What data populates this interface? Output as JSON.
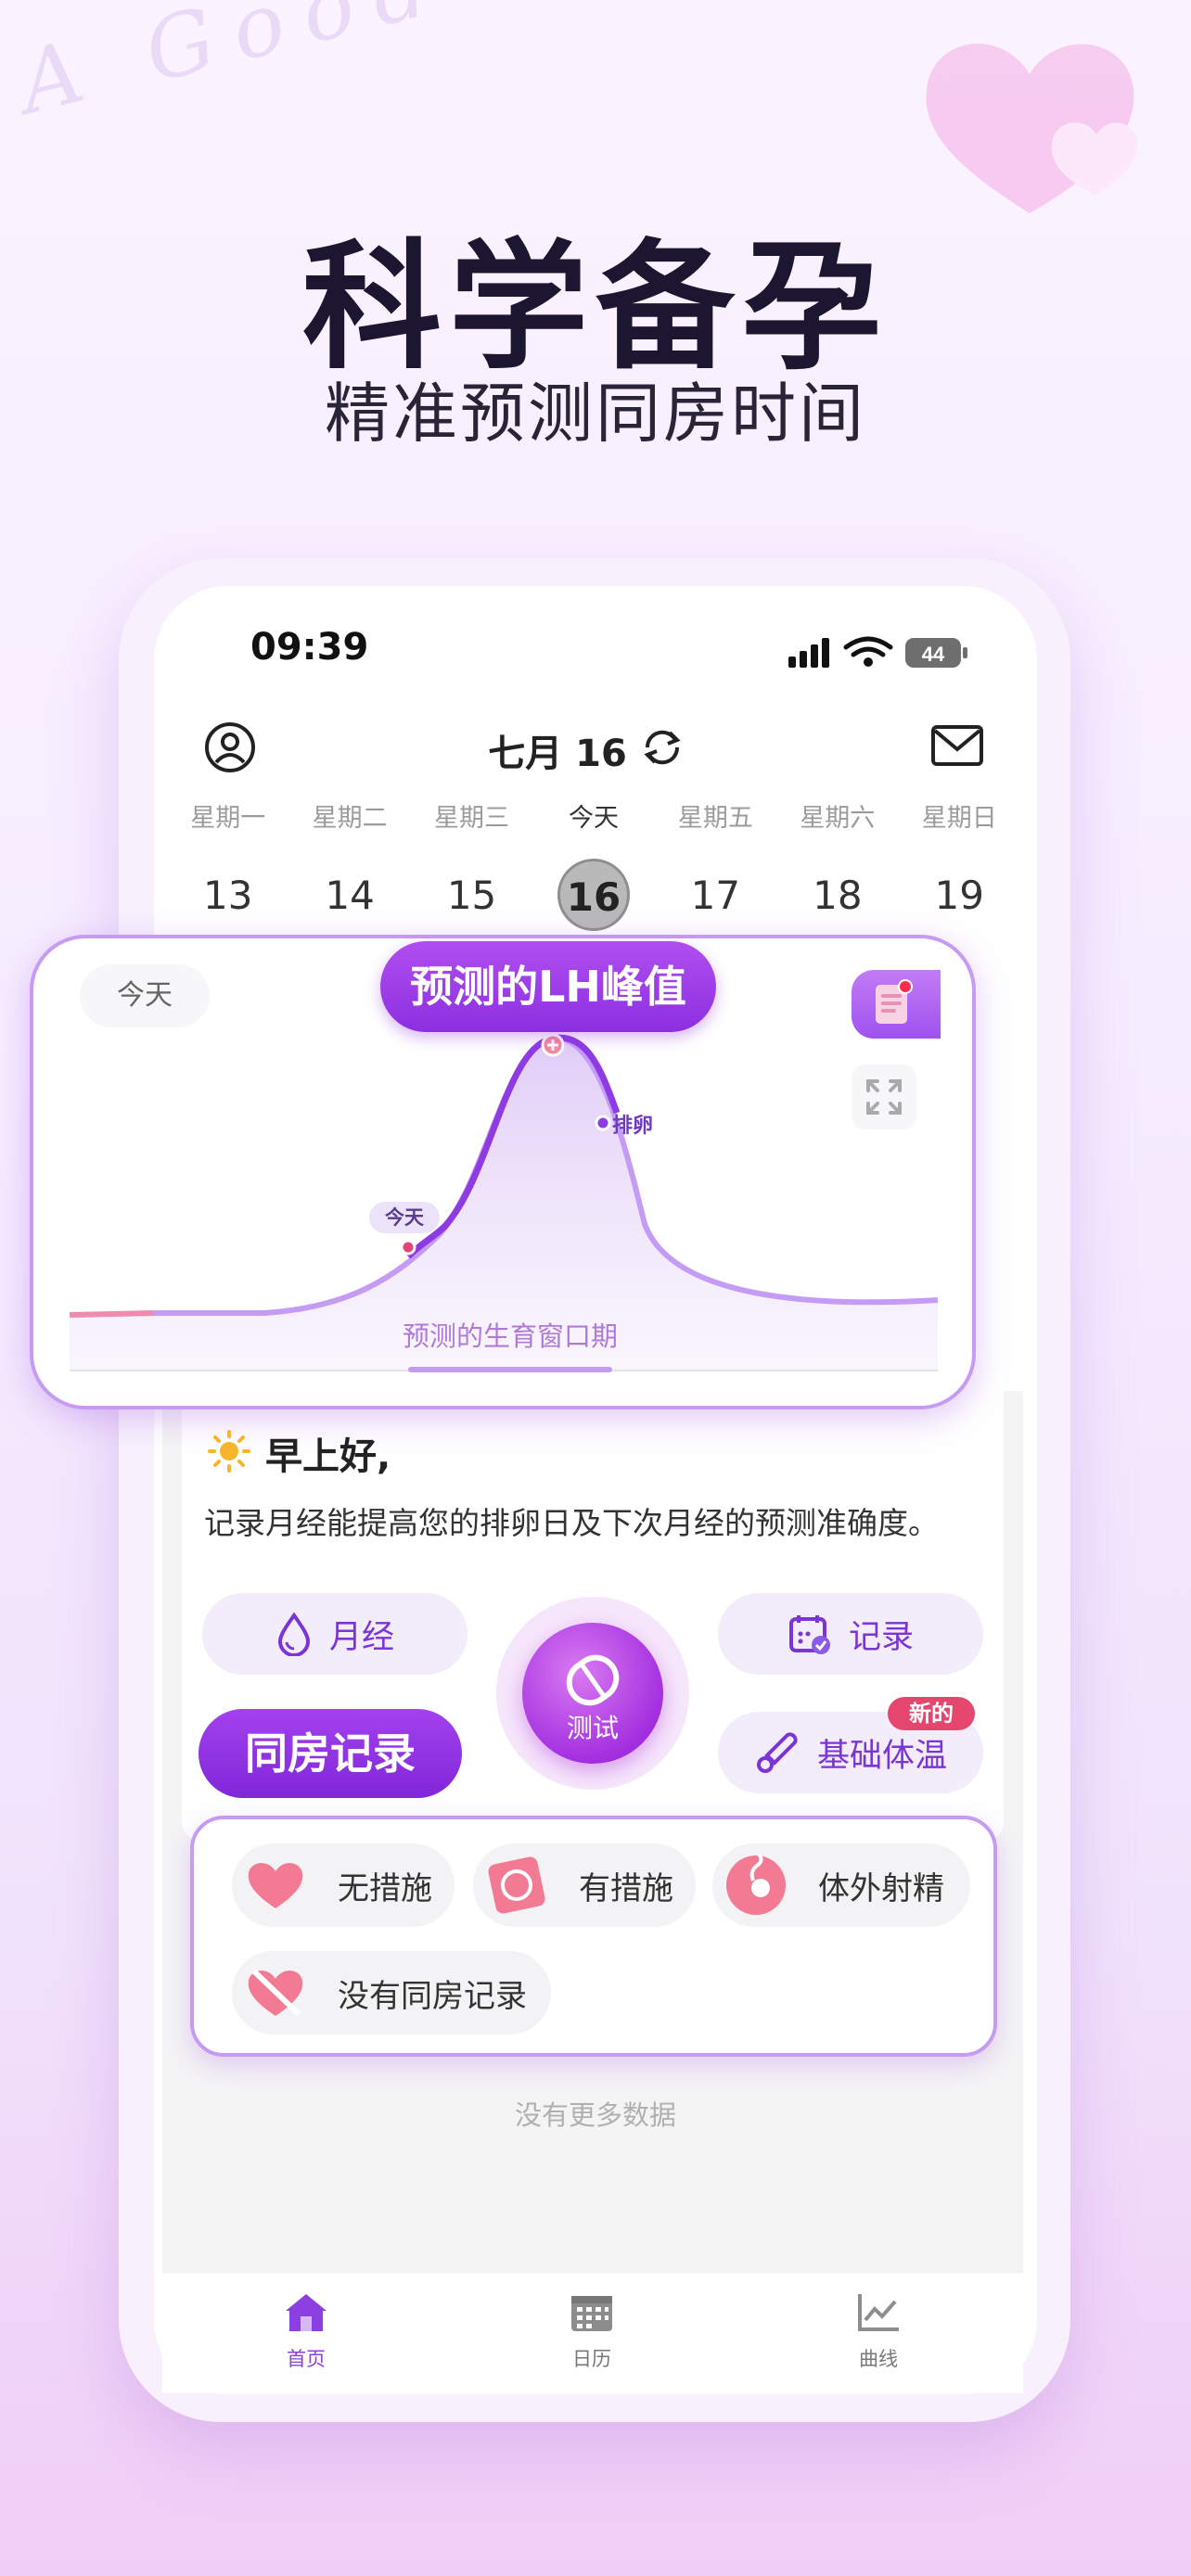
{
  "background": {
    "script_text": "A Good Helper"
  },
  "hero": {
    "title": "科学备孕",
    "subtitle": "精准预测同房时间"
  },
  "status_bar": {
    "time": "09:39",
    "battery": "44"
  },
  "header": {
    "date_month": "七月",
    "date_day": "16"
  },
  "week": [
    {
      "weekday": "星期一",
      "day": "13"
    },
    {
      "weekday": "星期二",
      "day": "14"
    },
    {
      "weekday": "星期三",
      "day": "15"
    },
    {
      "weekday": "今天",
      "day": "16",
      "selected": true
    },
    {
      "weekday": "星期五",
      "day": "17"
    },
    {
      "weekday": "星期六",
      "day": "18"
    },
    {
      "weekday": "星期日",
      "day": "19"
    }
  ],
  "chart": {
    "today_chip": "今天",
    "peak_label": "预测的LH峰值",
    "today_marker": "今天",
    "ovulation_label": "排卵",
    "window_label": "预测的生育窗口期"
  },
  "greeting": {
    "title": "早上好,",
    "message": "记录月经能提高您的排卵日及下次月经的预测准确度。"
  },
  "actions": {
    "period": "月经",
    "record": "记录",
    "intercourse_record": "同房记录",
    "test": "测试",
    "bbt": "基础体温",
    "bbt_badge": "新的"
  },
  "record_options": [
    {
      "label": "无措施",
      "icon": "heart-icon"
    },
    {
      "label": "有措施",
      "icon": "condom-icon"
    },
    {
      "label": "体外射精",
      "icon": "sperm-icon"
    },
    {
      "label": "没有同房记录",
      "icon": "broken-heart-icon"
    }
  ],
  "footer_note": "没有更多数据",
  "tabs": [
    {
      "label": "首页",
      "icon": "home-icon",
      "active": true
    },
    {
      "label": "日历",
      "icon": "calendar-icon"
    },
    {
      "label": "曲线",
      "icon": "line-chart-icon"
    }
  ],
  "colors": {
    "accent": "#8c2fe0",
    "accent_light": "#f2ecfb",
    "badge": "#e5466e",
    "period": "#f26d9a"
  }
}
